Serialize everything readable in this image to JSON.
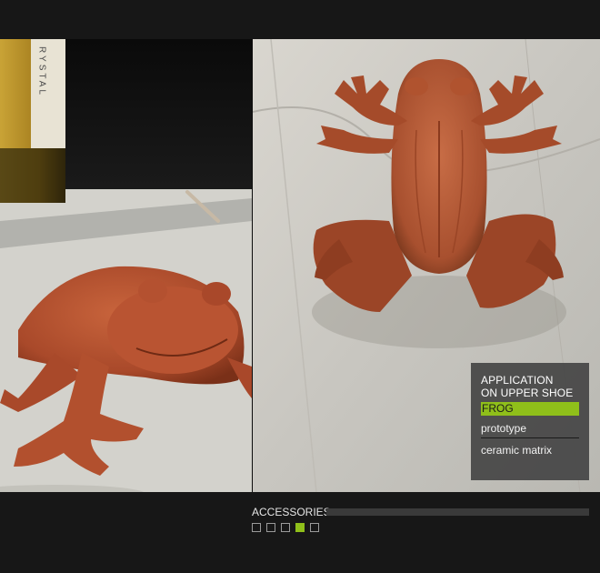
{
  "caption": {
    "title": "APPLICATION ON UPPER SHOE",
    "highlight": "FROG",
    "items": [
      "prototype",
      "ceramic matrix"
    ]
  },
  "photo_left": {
    "label_text": "RYSTAL"
  },
  "section": {
    "label": "ACCESSORIES"
  },
  "pager": {
    "count": 5,
    "active_index": 3
  },
  "colors": {
    "accent": "#8fbf1a",
    "background": "#171717",
    "caption_bg": "#464646"
  }
}
